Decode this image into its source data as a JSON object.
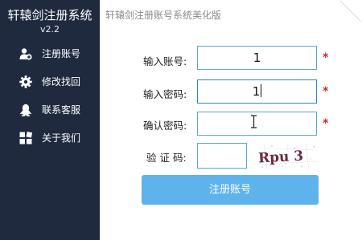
{
  "app": {
    "title": "轩辕剑注册系统",
    "version": "v2.2",
    "subtitle": "轩辕剑注册账号系统美化版"
  },
  "sidebar": {
    "items": [
      {
        "label": "注册账号",
        "icon": "add-user-icon"
      },
      {
        "label": "修改找回",
        "icon": "gear-icon"
      },
      {
        "label": "联系客服",
        "icon": "qq-penguin-icon"
      },
      {
        "label": "关于我们",
        "icon": "grid-icon"
      }
    ]
  },
  "form": {
    "account": {
      "label": "输入账号:",
      "value": "1"
    },
    "password": {
      "label": "输入密码:",
      "value": "1"
    },
    "confirm": {
      "label": "确认密码:",
      "value": ""
    },
    "captcha": {
      "label": "验 证 码:",
      "value": "",
      "image_text": "Rpu 3"
    },
    "required_mark": "*",
    "submit_label": "注册账号"
  },
  "colors": {
    "sidebar_bg": "#1f2a3e",
    "field_border": "#5aa7d8",
    "button_bg": "#5fb3ec",
    "required": "#e02020"
  }
}
